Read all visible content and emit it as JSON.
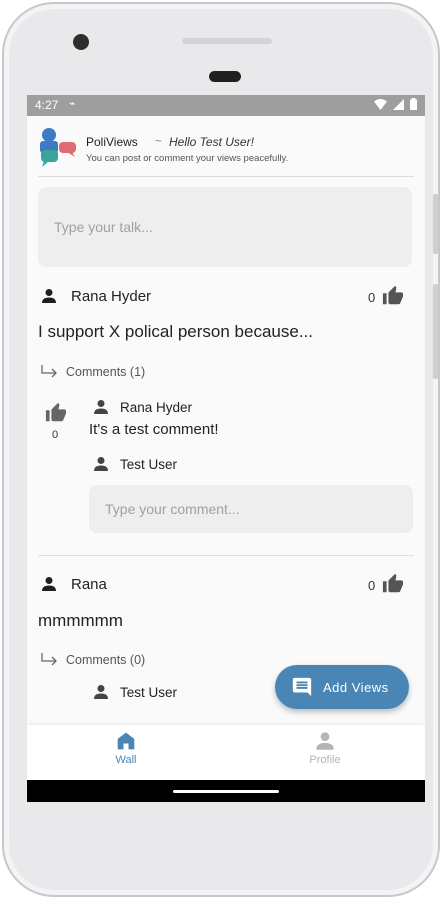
{
  "status_bar": {
    "time": "4:27"
  },
  "app": {
    "title": "PoliViews",
    "separator": "~",
    "greeting": "Hello Test User!",
    "tagline": "You can post or comment your views peacefully."
  },
  "composer": {
    "placeholder": "Type your talk..."
  },
  "posts": [
    {
      "author": "Rana Hyder",
      "likes": "0",
      "text": "I support X polical person because...",
      "comments_label": "Comments (1)",
      "comments": [
        {
          "author": "Rana Hyder",
          "text": "It's a test comment!",
          "likes": "0"
        }
      ],
      "current_user": "Test User",
      "comment_placeholder": "Type your comment..."
    },
    {
      "author": "Rana",
      "likes": "0",
      "text": "mmmmmm",
      "comments_label": "Comments (0)",
      "current_user": "Test User"
    }
  ],
  "fab": {
    "label": "Add Views",
    "icon": "comment-icon"
  },
  "bottom_nav": [
    {
      "label": "Wall",
      "icon": "home-icon",
      "active": true
    },
    {
      "label": "Profile",
      "icon": "person-icon",
      "active": false
    }
  ],
  "colors": {
    "accent": "#4a86b5",
    "inactive": "#b5b5b5",
    "text": "#222222"
  }
}
